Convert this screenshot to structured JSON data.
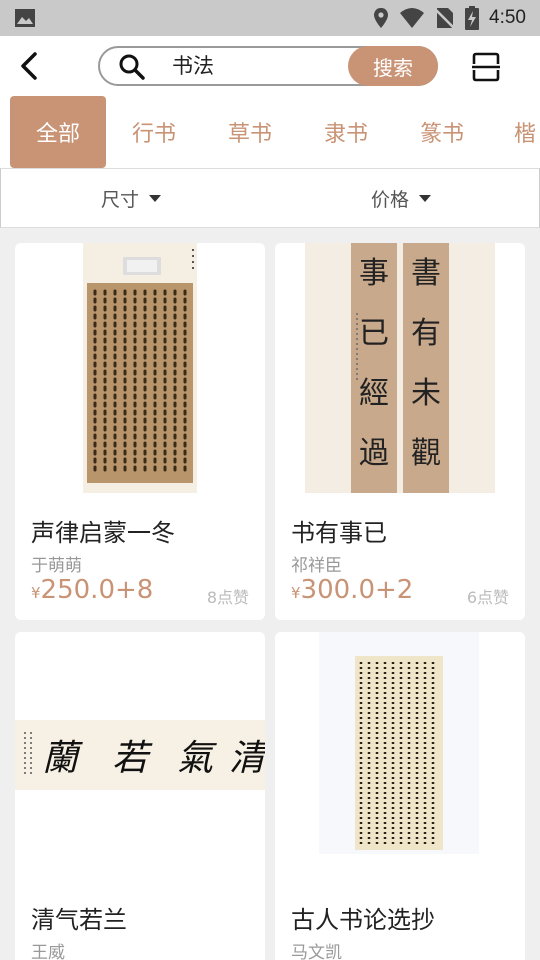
{
  "status_bar": {
    "time": "4:50"
  },
  "search": {
    "query": "书法",
    "button_label": "搜索"
  },
  "tabs": [
    {
      "label": "全部",
      "active": true
    },
    {
      "label": "行书",
      "active": false
    },
    {
      "label": "草书",
      "active": false
    },
    {
      "label": "隶书",
      "active": false
    },
    {
      "label": "篆书",
      "active": false
    },
    {
      "label": "楷",
      "active": false
    }
  ],
  "filters": {
    "size_label": "尺寸",
    "price_label": "价格"
  },
  "products": [
    {
      "title": "声律启蒙一冬",
      "author": "于萌萌",
      "currency": "¥",
      "price": "250.0+8",
      "likes": "8点赞"
    },
    {
      "title": "书有事已",
      "author": "祁祥臣",
      "currency": "¥",
      "price": "300.0+2",
      "likes": "6点赞"
    },
    {
      "title": "清气若兰",
      "author": "王威",
      "currency": "¥",
      "price": "",
      "likes": ""
    },
    {
      "title": "古人书论选抄",
      "author": "马文凯",
      "currency": "¥",
      "price": "",
      "likes": ""
    }
  ],
  "artwork_text": {
    "couplet_left": "事已經過而須提",
    "couplet_right": "書有未觀皆可讀",
    "banner": "清氣若蘭"
  },
  "colors": {
    "accent": "#c99375",
    "status_bar": "#c9c9c9",
    "background": "#efefef"
  }
}
